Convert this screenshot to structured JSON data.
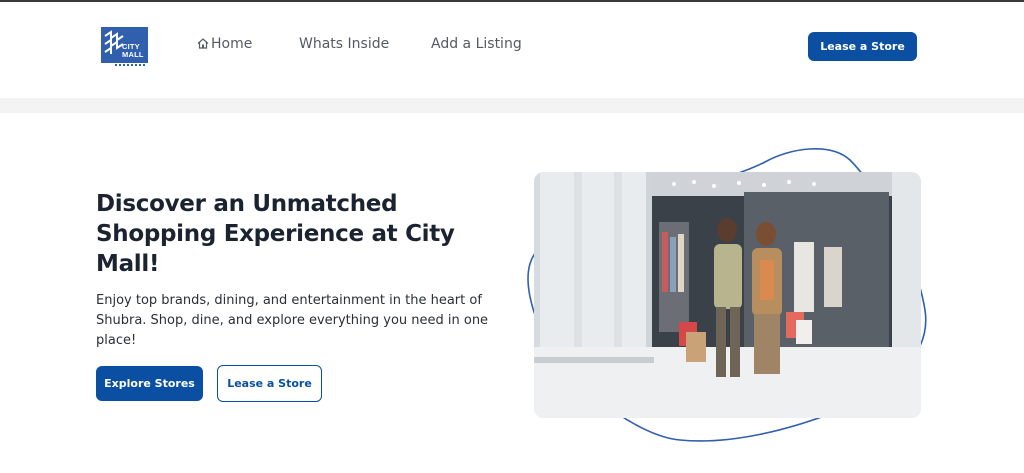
{
  "brand": {
    "logo_top": "CITY",
    "logo_bottom": "MALL"
  },
  "nav": {
    "home_label": "Home",
    "whats_inside_label": "Whats Inside",
    "add_listing_label": "Add a Listing",
    "lease_button_label": "Lease a Store"
  },
  "hero": {
    "title": "Discover an Unmatched Shopping Experience at City Mall!",
    "description": "Enjoy top brands, dining, and entertainment in the heart of Shubra. Shop, dine, and explore everything you need in one place!",
    "explore_button_label": "Explore Stores",
    "lease_button_label": "Lease a Store"
  },
  "colors": {
    "primary": "#0a4fa1",
    "logo": "#2f5fad",
    "band": "#f3f3f3",
    "heading": "#1b2330"
  },
  "icons": [
    "home-icon",
    "city-mall-logo"
  ]
}
